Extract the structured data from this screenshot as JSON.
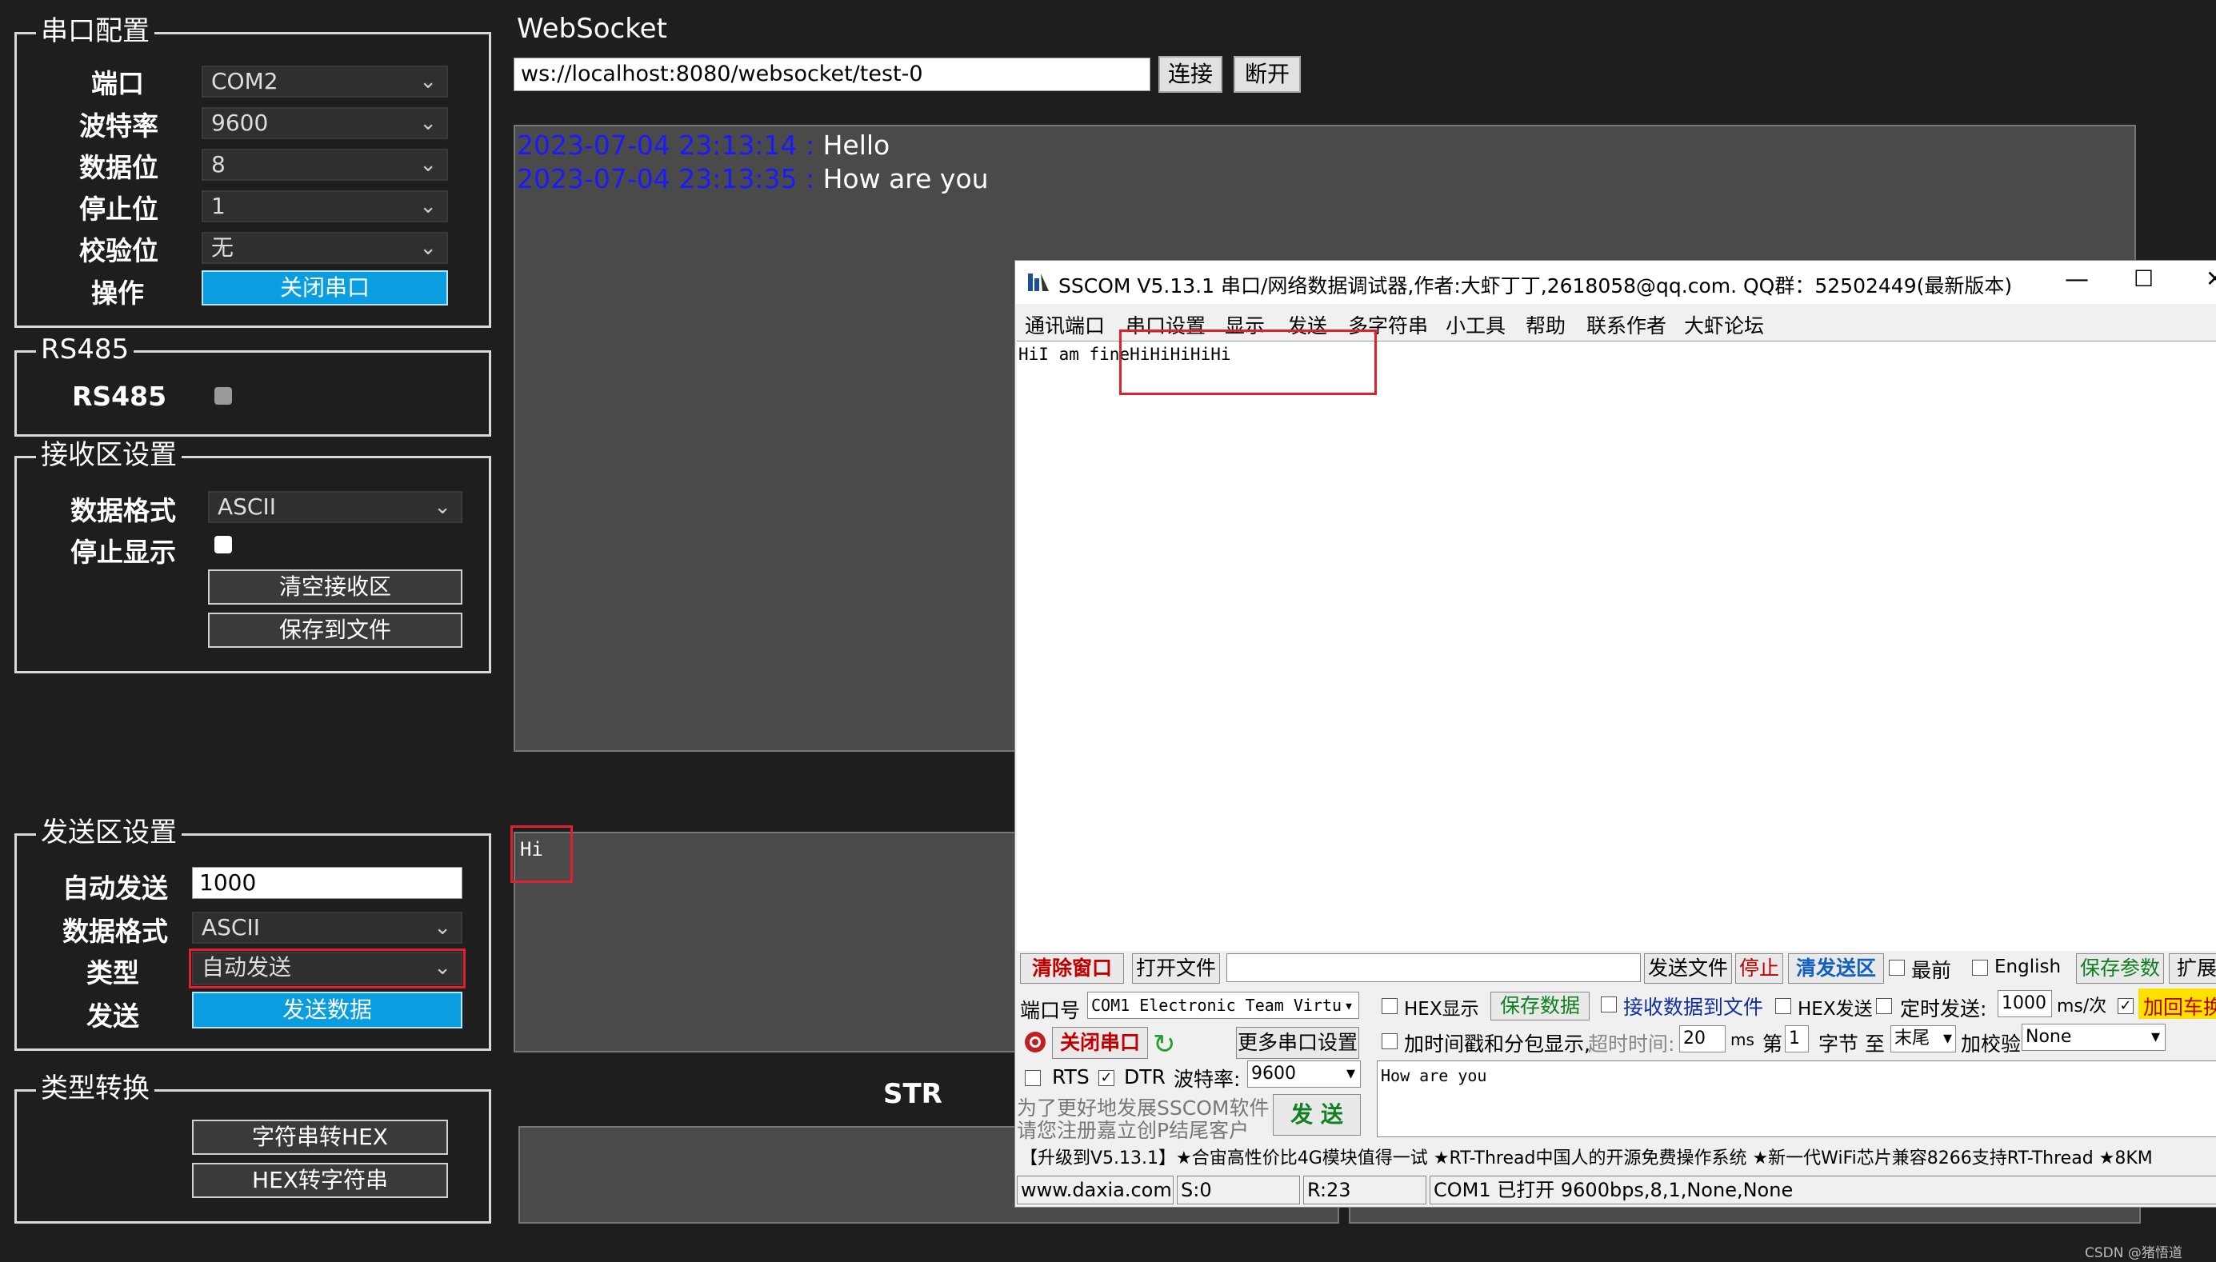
{
  "serial_config": {
    "legend": "串口配置",
    "port_label": "端口",
    "port_value": "COM2",
    "baud_label": "波特率",
    "baud_value": "9600",
    "databits_label": "数据位",
    "databits_value": "8",
    "stopbits_label": "停止位",
    "stopbits_value": "1",
    "parity_label": "校验位",
    "parity_value": "无",
    "action_label": "操作",
    "close_port_button": "关闭串口"
  },
  "rs485": {
    "legend": "RS485",
    "label": "RS485"
  },
  "receive": {
    "legend": "接收区设置",
    "format_label": "数据格式",
    "format_value": "ASCII",
    "stop_display_label": "停止显示",
    "clear_button": "清空接收区",
    "save_button": "保存到文件"
  },
  "send": {
    "legend": "发送区设置",
    "auto_send_label": "自动发送",
    "auto_send_value": "1000",
    "format_label": "数据格式",
    "format_value": "ASCII",
    "type_label": "类型",
    "type_value": "自动发送",
    "send_label": "发送",
    "send_button": "发送数据"
  },
  "convert": {
    "legend": "类型转换",
    "str_to_hex_button": "字符串转HEX",
    "hex_to_str_button": "HEX转字符串"
  },
  "websocket": {
    "title": "WebSocket",
    "url": "ws://localhost:8080/websocket/test-0",
    "connect_button": "连接",
    "disconnect_button": "断开",
    "messages": [
      {
        "time": "2023-07-04 23:13:14 :",
        "text": "Hello"
      },
      {
        "time": "2023-07-04 23:13:35 :",
        "text": "How are you"
      }
    ],
    "send_text": "Hi",
    "str_label": "STR",
    "time_color": "#1a1aff"
  },
  "sscom": {
    "title": "SSCOM V5.13.1 串口/网络数据调试器,作者:大虾丁丁,2618058@qq.com. QQ群：52502449(最新版本)",
    "menu": [
      "通讯端口",
      "串口设置",
      "显示",
      "发送",
      "多字符串",
      "小工具",
      "帮助",
      "联系作者",
      "大虾论坛"
    ],
    "receive_text_a": "HiI am fine",
    "receive_text_b": "HiHiHiHiHi",
    "clear_window": "清除窗口",
    "open_file": "打开文件",
    "send_file": "发送文件",
    "stop": "停止",
    "clear_send": "清发送区",
    "topmost": "最前",
    "english": "English",
    "save_params": "保存参数",
    "expand": "扩展",
    "port_no_label": "端口号",
    "port_value": "COM1 Electronic Team Virtu",
    "hex_display": "HEX显示",
    "save_data": "保存数据",
    "recv_to_file": "接收数据到文件",
    "hex_send": "HEX发送",
    "timed_send": "定时发送:",
    "timed_value": "1000",
    "timed_unit": "ms/次",
    "add_crlf": "加回车换",
    "close_port": "关闭串口",
    "more_settings": "更多串口设置",
    "timestamp_label": "加时间戳和分包显示,",
    "timeout_label": "超时时间:",
    "timeout_value": "20",
    "timeout_unit": "ms",
    "nth_label": "第",
    "nth_value": "1",
    "byte_to": "字节 至",
    "end_value": "末尾",
    "checksum_label": "加校验",
    "checksum_value": "None",
    "rts": "RTS",
    "dtr": "DTR",
    "baud_label": "波特率:",
    "baud_value": "9600",
    "send_input_text": "How are you",
    "promo_line1": "为了更好地发展SSCOM软件",
    "promo_line2": "请您注册嘉立创P结尾客户",
    "send_button": "发 送",
    "ticker": "【升级到V5.13.1】★合宙高性价比4G模块值得一试 ★RT-Thread中国人的开源免费操作系统 ★新一代WiFi芯片兼容8266支持RT-Thread ★8KM",
    "status_site": "www.daxia.com",
    "status_s": "S:0",
    "status_r": "R:23",
    "status_port": "COM1 已打开  9600bps,8,1,None,None"
  },
  "watermark": "CSDN @猪悟道"
}
